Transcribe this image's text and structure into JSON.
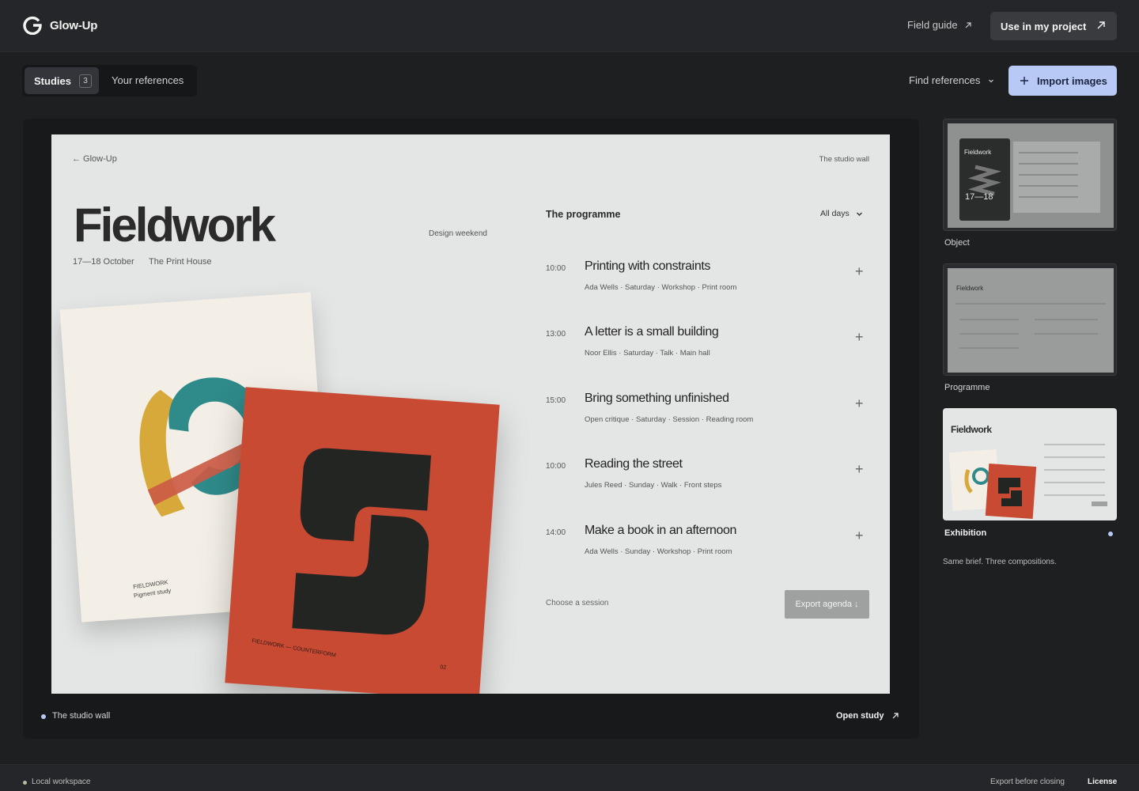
{
  "app": {
    "name": "Glow-Up",
    "logo_icon": "g-logo-icon"
  },
  "header": {
    "field_guide": "Field guide",
    "use_in_project": "Use in my project",
    "external_icon": "external-link-icon"
  },
  "toolbar": {
    "tabs": [
      {
        "label": "Studies",
        "count": "3",
        "selected": true
      },
      {
        "label": "Your references",
        "selected": false
      }
    ],
    "find_references": "Find references",
    "import_images": "Import images"
  },
  "study": {
    "label": "The studio wall",
    "open_label": "Open study",
    "artwork": {
      "back": "← Glow-Up",
      "wall": "The studio wall",
      "title": "Fieldwork",
      "dates": "17—18 October",
      "venue": "The Print House",
      "tagline": "Design weekend",
      "programme_title": "The programme",
      "filter": "All days",
      "sessions": [
        {
          "time": "10:00",
          "name": "Printing with constraints",
          "meta": "Ada Wells · Saturday · Workshop · Print room"
        },
        {
          "time": "13:00",
          "name": "A letter is a small building",
          "meta": "Noor Ellis · Saturday · Talk · Main hall"
        },
        {
          "time": "15:00",
          "name": "Bring something unfinished",
          "meta": "Open critique · Saturday · Session · Reading room"
        },
        {
          "time": "10:00",
          "name": "Reading the street",
          "meta": "Jules Reed · Sunday · Walk · Front steps"
        },
        {
          "time": "14:00",
          "name": "Make a book in an afternoon",
          "meta": "Ada Wells · Sunday · Workshop · Print room"
        }
      ],
      "choose": "Choose a session",
      "export": "Export agenda ↓",
      "card1_label1": "FIELDWORK",
      "card1_label2": "Pigment study",
      "card2_label": "FIELDWORK — COUNTERFORM",
      "card2_num": "02"
    }
  },
  "thumbnails": [
    {
      "label": "Object",
      "active": false,
      "mini_title": "Fieldwork",
      "mini_dates": "17—18"
    },
    {
      "label": "Programme",
      "active": false,
      "mini_title": "Fieldwork"
    },
    {
      "label": "Exhibition",
      "active": true,
      "mini_title": "Fieldwork"
    }
  ],
  "caption": "Same brief. Three compositions.",
  "footer": {
    "workspace": "Local workspace",
    "export_note": "Export before closing",
    "license": "License"
  },
  "colors": {
    "accent": "#b9c9f6",
    "poster_red": "#c94a33",
    "teal": "#2f8a8a",
    "ochre": "#d7a93a"
  }
}
